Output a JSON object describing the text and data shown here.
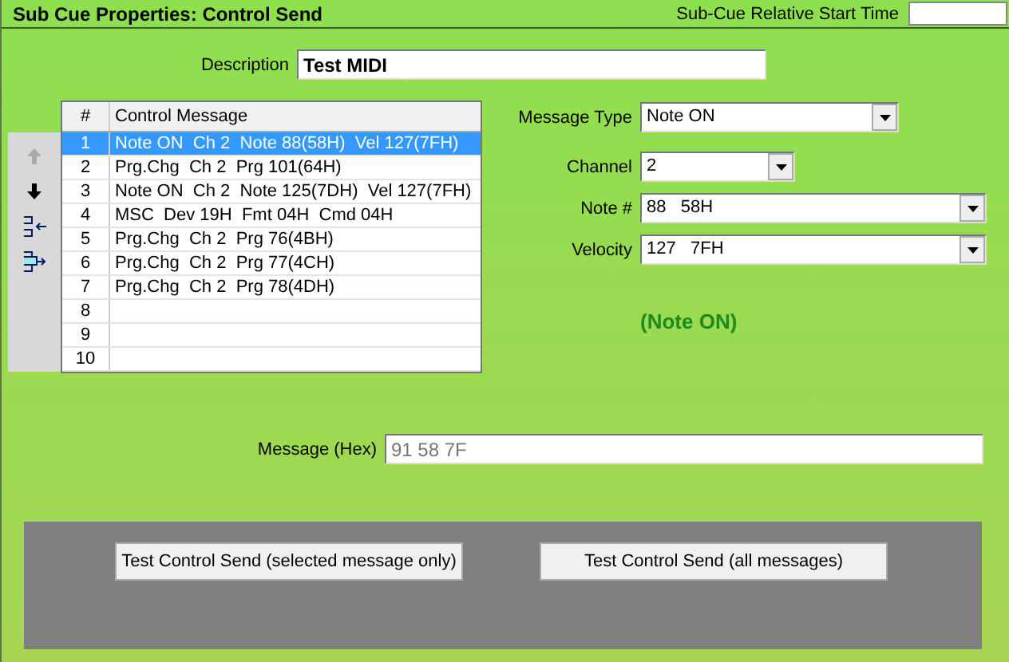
{
  "title": "Sub Cue Properties: Control Send",
  "start_time": {
    "label": "Sub-Cue Relative Start Time"
  },
  "description": {
    "label": "Description",
    "value": "Test MIDI"
  },
  "toolbar": [
    {
      "kind": "up",
      "disabled": true
    },
    {
      "kind": "down",
      "disabled": false
    },
    {
      "kind": "insert",
      "disabled": false
    },
    {
      "kind": "append",
      "disabled": false
    }
  ],
  "table": {
    "columns": [
      "#",
      "Control Message"
    ],
    "rows": [
      {
        "num": "1",
        "message": "Note ON  Ch 2  Note 88(58H)  Vel 127(7FH)",
        "selected": true
      },
      {
        "num": "2",
        "message": "Prg.Chg  Ch 2  Prg 101(64H)",
        "selected": false
      },
      {
        "num": "3",
        "message": "Note ON  Ch 2  Note 125(7DH)  Vel 127(7FH)",
        "selected": false
      },
      {
        "num": "4",
        "message": "MSC  Dev 19H  Fmt 04H  Cmd 04H",
        "selected": false
      },
      {
        "num": "5",
        "message": "Prg.Chg  Ch 2  Prg 76(4BH)",
        "selected": false
      },
      {
        "num": "6",
        "message": "Prg.Chg  Ch 2  Prg 77(4CH)",
        "selected": false
      },
      {
        "num": "7",
        "message": "Prg.Chg  Ch 2  Prg 78(4DH)",
        "selected": false
      },
      {
        "num": "8",
        "selected": false
      },
      {
        "num": "9",
        "selected": false
      },
      {
        "num": "10",
        "selected": false
      }
    ]
  },
  "fields": [
    {
      "label": "Message Type",
      "value": "Note ON"
    },
    {
      "label": "Channel",
      "value": "2"
    },
    {
      "label": "Note #",
      "value": "88   58H"
    },
    {
      "label": "Velocity",
      "value": "127   7FH"
    }
  ],
  "message_summary": "(Note ON)",
  "hex": {
    "label": "Message (Hex)",
    "value": "91 58 7F"
  },
  "buttons": [
    "Test Control Send (selected message only)",
    "Test Control Send (all messages)"
  ]
}
